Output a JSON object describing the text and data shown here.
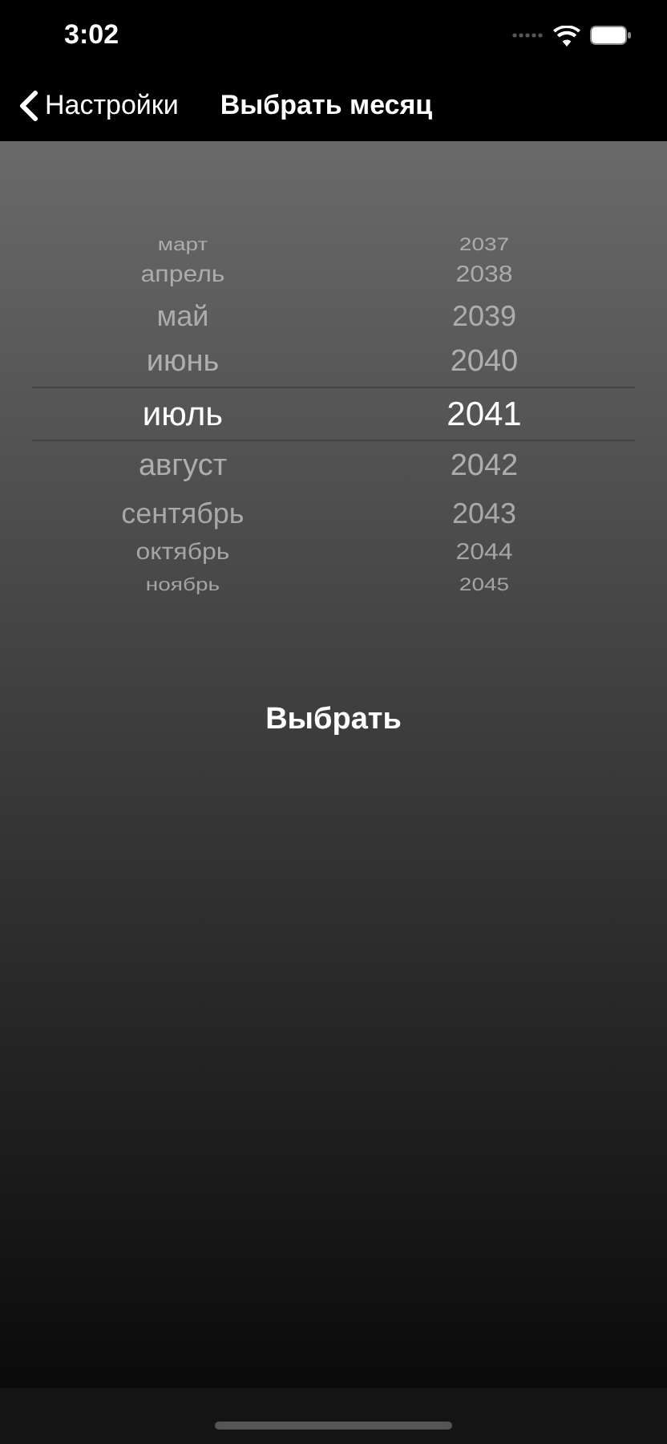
{
  "status_bar": {
    "time": "3:02"
  },
  "nav_bar": {
    "back_label": "Настройки",
    "title": "Выбрать месяц"
  },
  "picker": {
    "months": [
      {
        "label": "март",
        "selected": false
      },
      {
        "label": "апрель",
        "selected": false
      },
      {
        "label": "май",
        "selected": false
      },
      {
        "label": "июнь",
        "selected": false
      },
      {
        "label": "июль",
        "selected": true
      },
      {
        "label": "август",
        "selected": false
      },
      {
        "label": "сентябрь",
        "selected": false
      },
      {
        "label": "октябрь",
        "selected": false
      },
      {
        "label": "ноябрь",
        "selected": false
      }
    ],
    "years": [
      {
        "label": "2037",
        "selected": false
      },
      {
        "label": "2038",
        "selected": false
      },
      {
        "label": "2039",
        "selected": false
      },
      {
        "label": "2040",
        "selected": false
      },
      {
        "label": "2041",
        "selected": true
      },
      {
        "label": "2042",
        "selected": false
      },
      {
        "label": "2043",
        "selected": false
      },
      {
        "label": "2044",
        "selected": false
      },
      {
        "label": "2045",
        "selected": false
      }
    ]
  },
  "button": {
    "label": "Выбрать"
  }
}
